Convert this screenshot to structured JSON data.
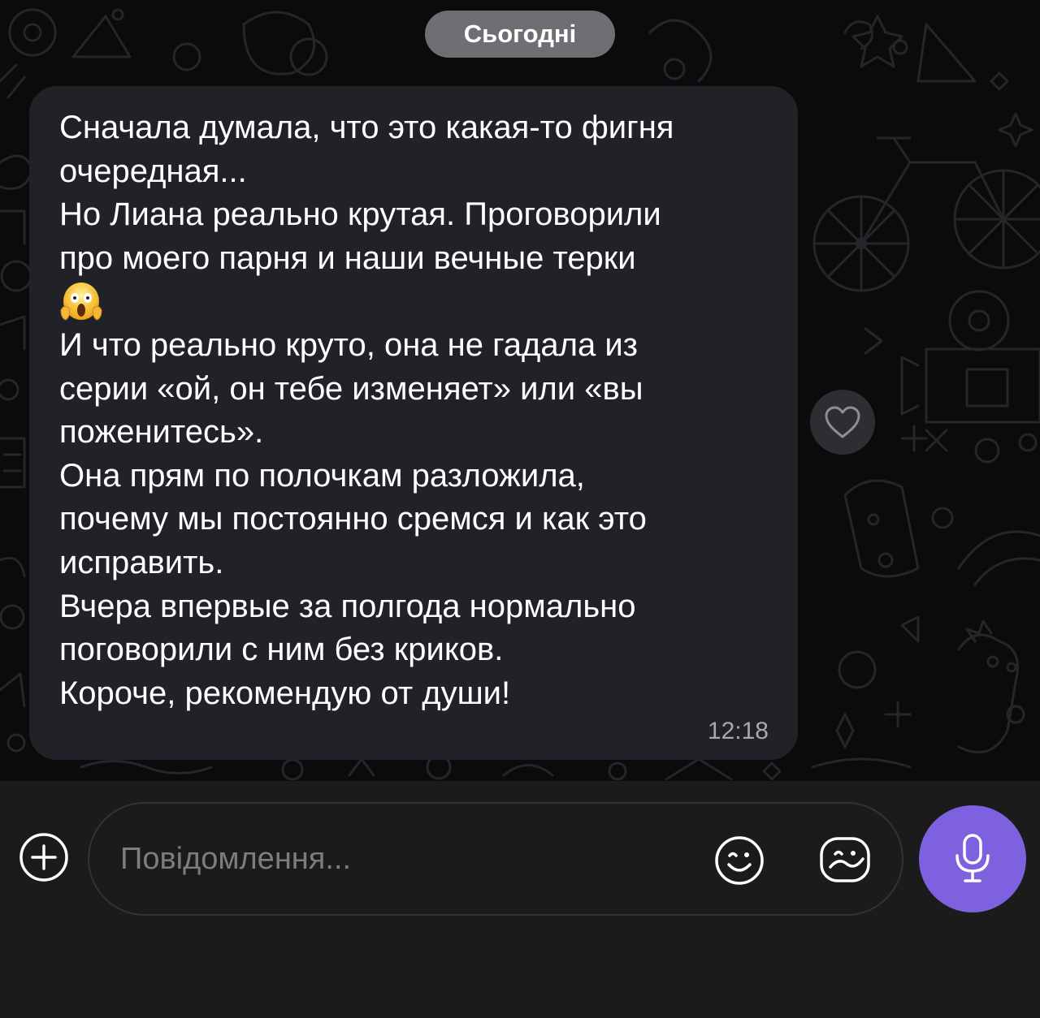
{
  "date_separator": "Сьогодні",
  "message": {
    "lines": [
      "Сначала думала, что это какая-то фигня",
      "очередная...",
      "Но Лиана реально крутая. Проговорили",
      "про моего парня и наши вечные терки",
      "{emoji}",
      "И что реально круто, она не гадала из",
      "серии «ой, он тебе изменяет» или «вы",
      "поженитесь».",
      "Она прям по полочкам разложила,",
      "почему мы постоянно сремся и как это",
      "исправить.",
      "Вчера впервые за полгода нормально",
      "поговорили с ним без криков.",
      "Короче, рекомендую от души!"
    ],
    "emoji_icon": "face-screaming-in-fear",
    "time": "12:18"
  },
  "reaction": {
    "icon": "heart-outline-icon"
  },
  "composer": {
    "placeholder": "Повідомлення...",
    "attach_icon": "plus-circle-icon",
    "emoji_icon": "smiley-icon",
    "sticker_icon": "sticker-icon",
    "mic_icon": "microphone-icon"
  },
  "colors": {
    "chat_background": "#0b0b0c",
    "bubble": "#212227",
    "date_pill": "#6f6f73",
    "input_bar": "#1b1b1c",
    "mic_button": "#7e61de",
    "time_text": "#a7a8ad"
  }
}
